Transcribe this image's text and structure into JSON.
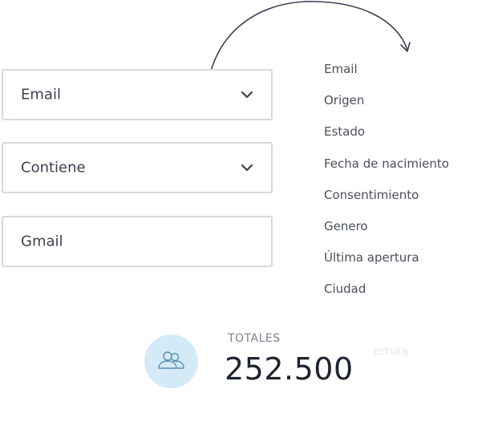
{
  "filters": {
    "field": {
      "value": "Email"
    },
    "operator": {
      "value": "Contiene"
    },
    "input": {
      "value": "Gmail"
    }
  },
  "dropdown": {
    "options": [
      "Email",
      "Origen",
      "Estado",
      "Fecha de nacimiento",
      "Consentimiento",
      "Genero",
      "Última apertura",
      "Ciudad"
    ]
  },
  "summary": {
    "label": "TOTALES",
    "value": "252.500",
    "icon": "users-icon",
    "ghost_text": "ertura"
  },
  "colors": {
    "border": "#d5d8df",
    "avatar_bg": "#d4eaf7",
    "icon": "#5b8fb3",
    "arrow": "#3b3f55",
    "value_text": "#1e2430"
  }
}
